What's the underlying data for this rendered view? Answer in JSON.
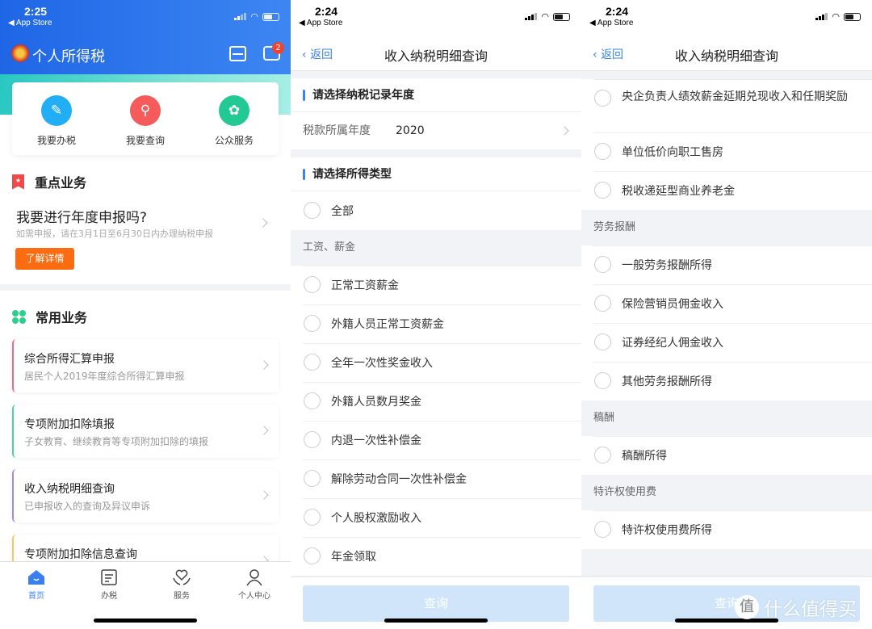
{
  "panel1": {
    "status": {
      "time": "2:25",
      "back_app": "◀ App Store"
    },
    "header": {
      "app_title": "个人所得税",
      "message_badge": "2"
    },
    "quick_actions": [
      {
        "label": "我要办税",
        "icon": "edit-icon",
        "color": "#21aef5"
      },
      {
        "label": "我要查询",
        "icon": "search-icon",
        "color": "#f55b5b"
      },
      {
        "label": "公众服务",
        "icon": "flower-icon",
        "color": "#22c992"
      }
    ],
    "key_business": {
      "section_title": "重点业务",
      "title": "我要进行年度申报吗?",
      "subtitle": "如需申报，请在3月1日至6月30日内办理纳税申报",
      "button": "了解详情"
    },
    "common_business": {
      "section_title": "常用业务",
      "cards": [
        {
          "title": "综合所得汇算申报",
          "subtitle": "居民个人2019年度综合所得汇算申报",
          "accent": "#f26b86"
        },
        {
          "title": "专项附加扣除填报",
          "subtitle": "子女教育、继续教育等专项附加扣除的填报",
          "accent": "#4cd49a"
        },
        {
          "title": "收入纳税明细查询",
          "subtitle": "已申报收入的查询及异议申诉",
          "accent": "#9b8cf0"
        },
        {
          "title": "专项附加扣除信息查询",
          "subtitle": "",
          "accent": "#f7c46c"
        }
      ]
    },
    "tabs": [
      {
        "label": "首页",
        "icon": "home-icon",
        "active": true
      },
      {
        "label": "办税",
        "icon": "document-edit-icon",
        "active": false
      },
      {
        "label": "服务",
        "icon": "heart-hands-icon",
        "active": false
      },
      {
        "label": "个人中心",
        "icon": "person-icon",
        "active": false
      }
    ],
    "active_color": "#3a7ff0"
  },
  "panel2": {
    "status": {
      "time": "2:24",
      "back_app": "◀ App Store"
    },
    "nav": {
      "back": "返回",
      "title": "收入纳税明细查询"
    },
    "year_section": "请选择纳税记录年度",
    "year_row": {
      "label": "税款所属年度",
      "value": "2020"
    },
    "type_section": "请选择所得类型",
    "all_option": "全部",
    "group": "工资、薪金",
    "options": [
      "正常工资薪金",
      "外籍人员正常工资薪金",
      "全年一次性奖金收入",
      "外籍人员数月奖金",
      "内退一次性补偿金",
      "解除劳动合同一次性补偿金",
      "个人股权激励收入",
      "年金领取"
    ],
    "query_button": "查询"
  },
  "panel3": {
    "status": {
      "time": "2:24",
      "back_app": "◀ App Store"
    },
    "nav": {
      "back": "返回",
      "title": "收入纳税明细查询"
    },
    "top_options": [
      "央企负责人绩效薪金延期兑现收入和任期奖励",
      "单位低价向职工售房",
      "税收递延型商业养老金"
    ],
    "groups": [
      {
        "name": "劳务报酬",
        "options": [
          "一般劳务报酬所得",
          "保险营销员佣金收入",
          "证券经纪人佣金收入",
          "其他劳务报酬所得"
        ]
      },
      {
        "name": "稿酬",
        "options": [
          "稿酬所得"
        ]
      },
      {
        "name": "特许权使用费",
        "options": [
          "特许权使用费所得"
        ]
      }
    ],
    "query_button": "查询"
  },
  "watermark": {
    "glyph": "值",
    "text": "什么值得买"
  }
}
